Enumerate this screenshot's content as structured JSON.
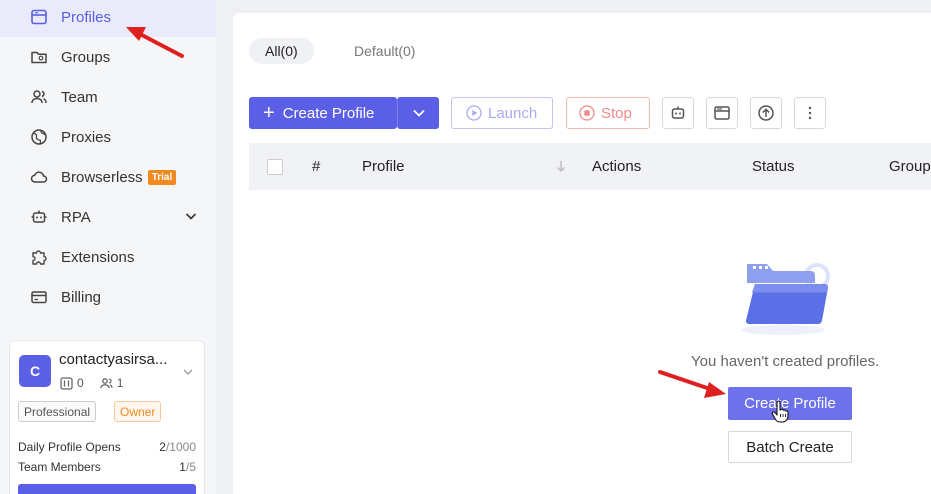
{
  "sidebar": {
    "items": [
      {
        "label": "Profiles",
        "icon": "profiles-icon",
        "active": true
      },
      {
        "label": "Groups",
        "icon": "folder-icon"
      },
      {
        "label": "Team",
        "icon": "team-icon"
      },
      {
        "label": "Proxies",
        "icon": "globe-icon"
      },
      {
        "label": "Browserless",
        "icon": "cloud-icon",
        "badge": "Trial"
      },
      {
        "label": "RPA",
        "icon": "robot-icon"
      },
      {
        "label": "Extensions",
        "icon": "puzzle-icon"
      },
      {
        "label": "Billing",
        "icon": "card-icon"
      }
    ],
    "user": {
      "initial": "C",
      "name": "contactyasirsa...",
      "profile_count": "0",
      "member_count": "1",
      "tag_plan": "Professional",
      "tag_role": "Owner",
      "daily_opens_label": "Daily Profile Opens",
      "daily_opens_used": "2",
      "daily_opens_max": "/1000",
      "team_members_label": "Team Members",
      "team_members_used": "1",
      "team_members_max": "/5"
    }
  },
  "main": {
    "tabs": [
      {
        "label": "All(0)",
        "active": true
      },
      {
        "label": "Default(0)"
      }
    ],
    "toolbar": {
      "create_label": "Create Profile",
      "launch_label": "Launch",
      "stop_label": "Stop"
    },
    "table": {
      "columns": [
        "#",
        "Profile",
        "Actions",
        "Status",
        "Group"
      ]
    },
    "empty": {
      "message": "You haven't created profiles.",
      "create_label": "Create Profile",
      "batch_label": "Batch Create"
    }
  },
  "colors": {
    "accent": "#5b5fe6",
    "annotation_arrow": "#e02020",
    "trial_badge": "#f08a1f"
  }
}
